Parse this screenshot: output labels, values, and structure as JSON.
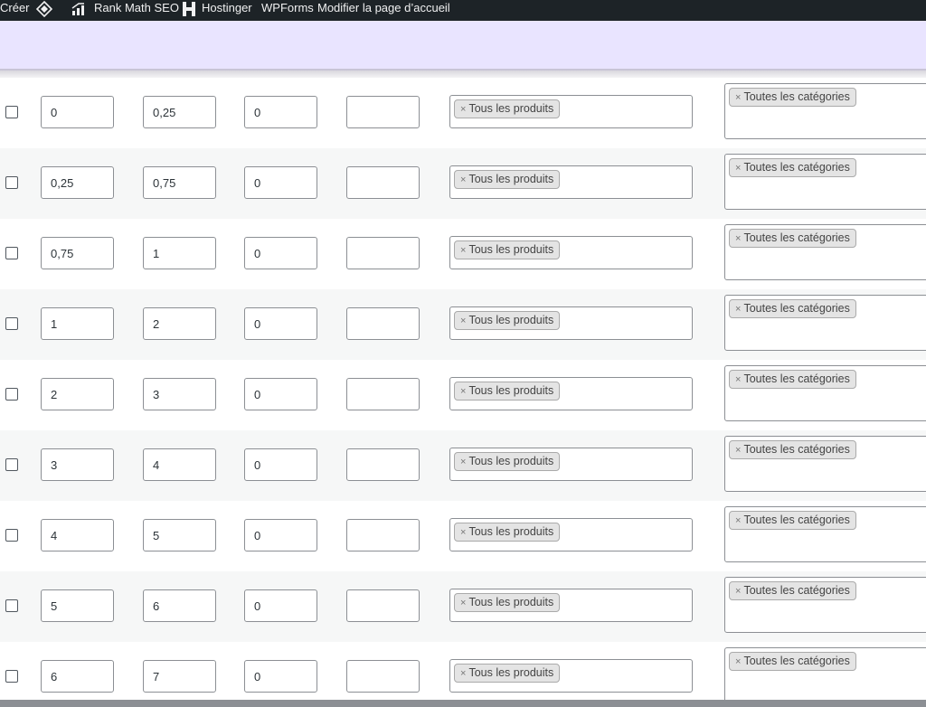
{
  "adminbar": {
    "create_label": "Créer",
    "rankmath_label": "Rank Math SEO",
    "hostinger_label": "Hostinger",
    "wpforms_label": "WPForms",
    "edit_page_label": "Modifier la page d’accueil"
  },
  "rows": [
    {
      "min": "0",
      "max": "0,25",
      "cost": "0",
      "extra": "",
      "products_chip": "Tous les produits",
      "categories_chip": "Toutes les catégories"
    },
    {
      "min": "0,25",
      "max": "0,75",
      "cost": "0",
      "extra": "",
      "products_chip": "Tous les produits",
      "categories_chip": "Toutes les catégories"
    },
    {
      "min": "0,75",
      "max": "1",
      "cost": "0",
      "extra": "",
      "products_chip": "Tous les produits",
      "categories_chip": "Toutes les catégories"
    },
    {
      "min": "1",
      "max": "2",
      "cost": "0",
      "extra": "",
      "products_chip": "Tous les produits",
      "categories_chip": "Toutes les catégories"
    },
    {
      "min": "2",
      "max": "3",
      "cost": "0",
      "extra": "",
      "products_chip": "Tous les produits",
      "categories_chip": "Toutes les catégories"
    },
    {
      "min": "3",
      "max": "4",
      "cost": "0",
      "extra": "",
      "products_chip": "Tous les produits",
      "categories_chip": "Toutes les catégories"
    },
    {
      "min": "4",
      "max": "5",
      "cost": "0",
      "extra": "",
      "products_chip": "Tous les produits",
      "categories_chip": "Toutes les catégories"
    },
    {
      "min": "5",
      "max": "6",
      "cost": "0",
      "extra": "",
      "products_chip": "Tous les produits",
      "categories_chip": "Toutes les catégories"
    },
    {
      "min": "6",
      "max": "7",
      "cost": "0",
      "extra": "",
      "products_chip": "Tous les produits",
      "categories_chip": "Toutes les catégories"
    }
  ],
  "chip_remove_glyph": "×",
  "colors": {
    "adminbar_bg": "#1d2327",
    "banner_bg": "#e9e4ff",
    "row_alt_bg": "#f6f7f7"
  }
}
